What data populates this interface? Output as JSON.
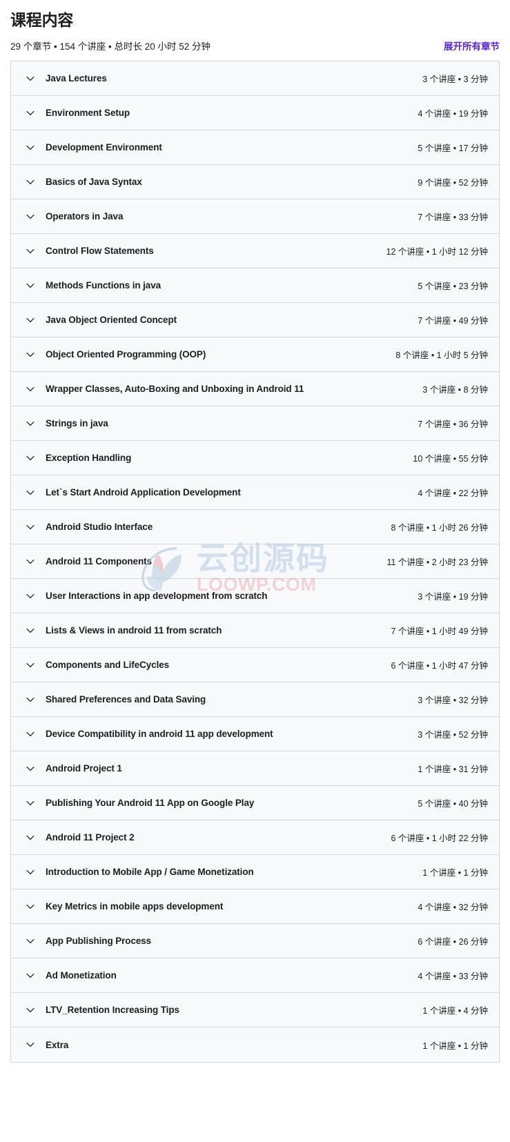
{
  "header": {
    "title": "课程内容",
    "summary": "29 个章节 • 154 个讲座 • 总时长 20 小时 52 分钟",
    "expand_all_label": "展开所有章节",
    "accent_color": "#5624d0"
  },
  "watermark": {
    "chinese_text": "云创源码",
    "english_text": "LOOWP.COM",
    "chinese_color": "#b9cbe3",
    "english_color": "#efb3b8"
  },
  "sections": [
    {
      "title": "Java Lectures",
      "meta": "3 个讲座 • 3 分钟"
    },
    {
      "title": "Environment Setup",
      "meta": "4 个讲座 • 19 分钟"
    },
    {
      "title": "Development Environment",
      "meta": "5 个讲座 • 17 分钟"
    },
    {
      "title": "Basics of Java Syntax",
      "meta": "9 个讲座 • 52 分钟"
    },
    {
      "title": "Operators in Java",
      "meta": "7 个讲座 • 33 分钟"
    },
    {
      "title": "Control Flow Statements",
      "meta": "12 个讲座 • 1 小时 12 分钟"
    },
    {
      "title": "Methods Functions in java",
      "meta": "5 个讲座 • 23 分钟"
    },
    {
      "title": "Java Object Oriented Concept",
      "meta": "7 个讲座 • 49 分钟"
    },
    {
      "title": "Object Oriented Programming (OOP)",
      "meta": "8 个讲座 • 1 小时 5 分钟"
    },
    {
      "title": "Wrapper Classes, Auto-Boxing and Unboxing in Android 11",
      "meta": "3 个讲座 • 8 分钟"
    },
    {
      "title": "Strings in java",
      "meta": "7 个讲座 • 36 分钟"
    },
    {
      "title": "Exception Handling",
      "meta": "10 个讲座 • 55 分钟"
    },
    {
      "title": "Let`s Start Android Application Development",
      "meta": "4 个讲座 • 22 分钟"
    },
    {
      "title": "Android Studio Interface",
      "meta": "8 个讲座 • 1 小时 26 分钟"
    },
    {
      "title": "Android 11 Components",
      "meta": "11 个讲座 • 2 小时 23 分钟"
    },
    {
      "title": "User Interactions in app development from scratch",
      "meta": "3 个讲座 • 19 分钟"
    },
    {
      "title": "Lists & Views in android 11 from scratch",
      "meta": "7 个讲座 • 1 小时 49 分钟"
    },
    {
      "title": "Components and LifeCycles",
      "meta": "6 个讲座 • 1 小时 47 分钟"
    },
    {
      "title": "Shared Preferences and Data Saving",
      "meta": "3 个讲座 • 32 分钟"
    },
    {
      "title": "Device Compatibility in android 11 app development",
      "meta": "3 个讲座 • 52 分钟"
    },
    {
      "title": "Android Project 1",
      "meta": "1 个讲座 • 31 分钟"
    },
    {
      "title": "Publishing Your Android 11 App on Google Play",
      "meta": "5 个讲座 • 40 分钟"
    },
    {
      "title": "Android 11 Project 2",
      "meta": "6 个讲座 • 1 小时 22 分钟"
    },
    {
      "title": "Introduction to Mobile App / Game Monetization",
      "meta": "1 个讲座 • 1 分钟"
    },
    {
      "title": "Key Metrics in mobile apps development",
      "meta": "4 个讲座 • 32 分钟"
    },
    {
      "title": "App Publishing Process",
      "meta": "6 个讲座 • 26 分钟"
    },
    {
      "title": "Ad Monetization",
      "meta": "4 个讲座 • 33 分钟"
    },
    {
      "title": "LTV_Retention Increasing Tips",
      "meta": "1 个讲座 • 4 分钟"
    },
    {
      "title": "Extra",
      "meta": "1 个讲座 • 1 分钟"
    }
  ]
}
